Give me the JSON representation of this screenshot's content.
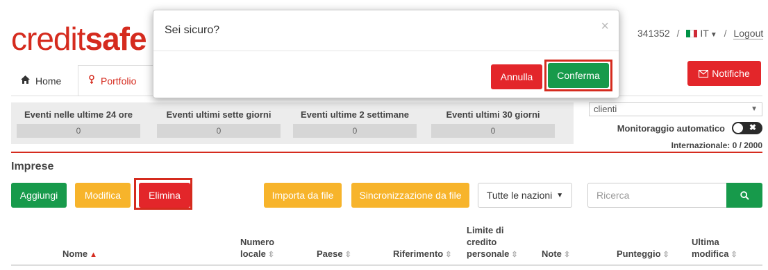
{
  "logo": {
    "part1": "credit",
    "part2": "safe"
  },
  "header": {
    "account_fragment": "341352",
    "separator": "/",
    "language": "IT",
    "logout": "Logout",
    "flag_colors": [
      "#009246",
      "#ffffff",
      "#ce2b37"
    ]
  },
  "tabs": [
    {
      "label": "Home",
      "icon": "home-icon"
    },
    {
      "label": "Portfolio",
      "icon": "portfolio-icon",
      "active": true
    }
  ],
  "notifiche": {
    "label": "Notifiche",
    "icon": "envelope-icon"
  },
  "stats": [
    {
      "label": "Eventi nelle ultime 24 ore",
      "value": "0"
    },
    {
      "label": "Eventi ultimi sette giorni",
      "value": "0"
    },
    {
      "label": "Eventi ultime 2 settimane",
      "value": "0"
    },
    {
      "label": "Eventi ultimi 30 giorni",
      "value": "0"
    }
  ],
  "right_panel": {
    "select_value": "clienti",
    "monitor_label": "Monitoraggio automatico",
    "international": "Internazionale: 0 / 2000"
  },
  "section_title": "Imprese",
  "toolbar": {
    "add": "Aggiungi",
    "edit": "Modifica",
    "delete": "Elimina",
    "import": "Importa da file",
    "sync": "Sincronizzazione da file",
    "nations": "Tutte le nazioni",
    "search_placeholder": "Ricerca"
  },
  "columns": {
    "name": "Nome",
    "local_number_1": "Numero",
    "local_number_2": "locale",
    "country": "Paese",
    "reference": "Riferimento",
    "credit_1": "Limite di",
    "credit_2": "credito",
    "credit_3": "personale",
    "notes": "Note",
    "score": "Punteggio",
    "last_1": "Ultima",
    "last_2": "modifica"
  },
  "modal": {
    "title": "Sei sicuro?",
    "close": "×",
    "cancel": "Annulla",
    "confirm": "Conferma"
  },
  "colors": {
    "brand_red": "#d52b1e",
    "green": "#179a4b",
    "yellow": "#f7b42b"
  }
}
